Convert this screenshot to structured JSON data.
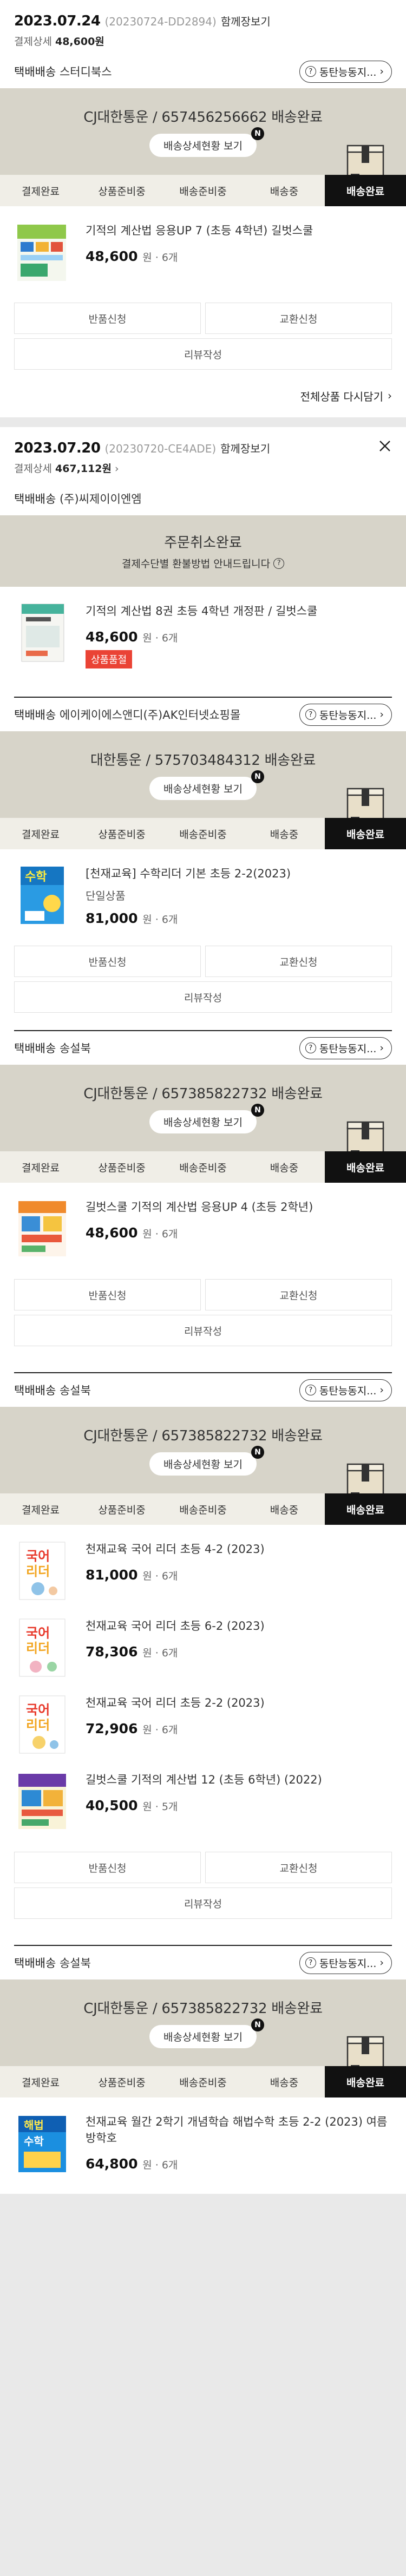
{
  "labels": {
    "order_detail": "결제상세",
    "view_all": "함께장보기",
    "shipping_type": "택배배송",
    "cs_button": "동탄능동지...",
    "tracking_button": "배송상세현황 보기",
    "new_badge": "N",
    "return_request": "반품신청",
    "exchange_request": "교환신청",
    "write_review": "리뷰작성",
    "reorder_all": "전체상품 다시담기",
    "currency_unit": "원",
    "qty_sep": " · "
  },
  "steps": [
    "결제완료",
    "상품준비중",
    "배송준비중",
    "배송중",
    "배송완료"
  ],
  "orders": [
    {
      "date": "2023.07.24",
      "order_no": "(20230724-DD2894)",
      "payment_amount": "48,600원",
      "packages": [
        {
          "seller": "스터디북스",
          "tracking": "CJ대한통운 / 657456256662 배송완료",
          "items": [
            {
              "name": "기적의 계산법 응용UP 7 (초등 4학년) 길벗스쿨",
              "price": "48,600",
              "qty": "6개"
            }
          ]
        }
      ]
    },
    {
      "date": "2023.07.20",
      "order_no": "(20230720-CE4ADE)",
      "payment_amount": "467,112원",
      "cancel": {
        "title": "주문취소완료",
        "sub": "결제수단별 환불방법 안내드립니다"
      },
      "packages": [
        {
          "seller": "(주)씨제이이엔엠",
          "cancelled": true,
          "items": [
            {
              "name": "기적의 계산법 8권 초등 4학년 개정판 / 길벗스쿨",
              "price": "48,600",
              "qty": "6개",
              "badge": "상품품절"
            }
          ]
        },
        {
          "seller": "에이케이에스앤디(주)AK인터넷쇼핑몰",
          "tracking": "대한통운 / 575703484312 배송완료",
          "items": [
            {
              "name": "[천재교육] 수학리더 기본 초등 2-2(2023)",
              "sub": "단일상품",
              "price": "81,000",
              "qty": "6개"
            }
          ]
        },
        {
          "seller": "송설북",
          "tracking": "CJ대한통운 / 657385822732 배송완료",
          "items": [
            {
              "name": "길벗스쿨 기적의 계산법 응용UP 4 (초등 2학년)",
              "price": "48,600",
              "qty": "6개"
            }
          ]
        },
        {
          "seller": "송설북",
          "tracking": "CJ대한통운 / 657385822732 배송완료",
          "items": [
            {
              "name": "천재교육 국어 리더 초등 4-2 (2023)",
              "price": "81,000",
              "qty": "6개"
            },
            {
              "name": "천재교육 국어 리더 초등 6-2 (2023)",
              "price": "78,306",
              "qty": "6개"
            },
            {
              "name": "천재교육 국어 리더 초등 2-2 (2023)",
              "price": "72,906",
              "qty": "6개"
            },
            {
              "name": "길벗스쿨 기적의 계산법 12 (초등 6학년) (2022)",
              "price": "40,500",
              "qty": "5개"
            }
          ]
        },
        {
          "seller": "송설북",
          "tracking": "CJ대한통운 / 657385822732 배송완료",
          "items": [
            {
              "name": "천재교육 월간 2학기 개념학습 해법수학 초등 2-2 (2023) 여름방학호",
              "price": "64,800",
              "qty": "6개"
            }
          ]
        }
      ]
    }
  ],
  "colors": {
    "track_bg": "#d7d4c9",
    "step_active": "#111111",
    "sold_out": "#ea4335"
  }
}
